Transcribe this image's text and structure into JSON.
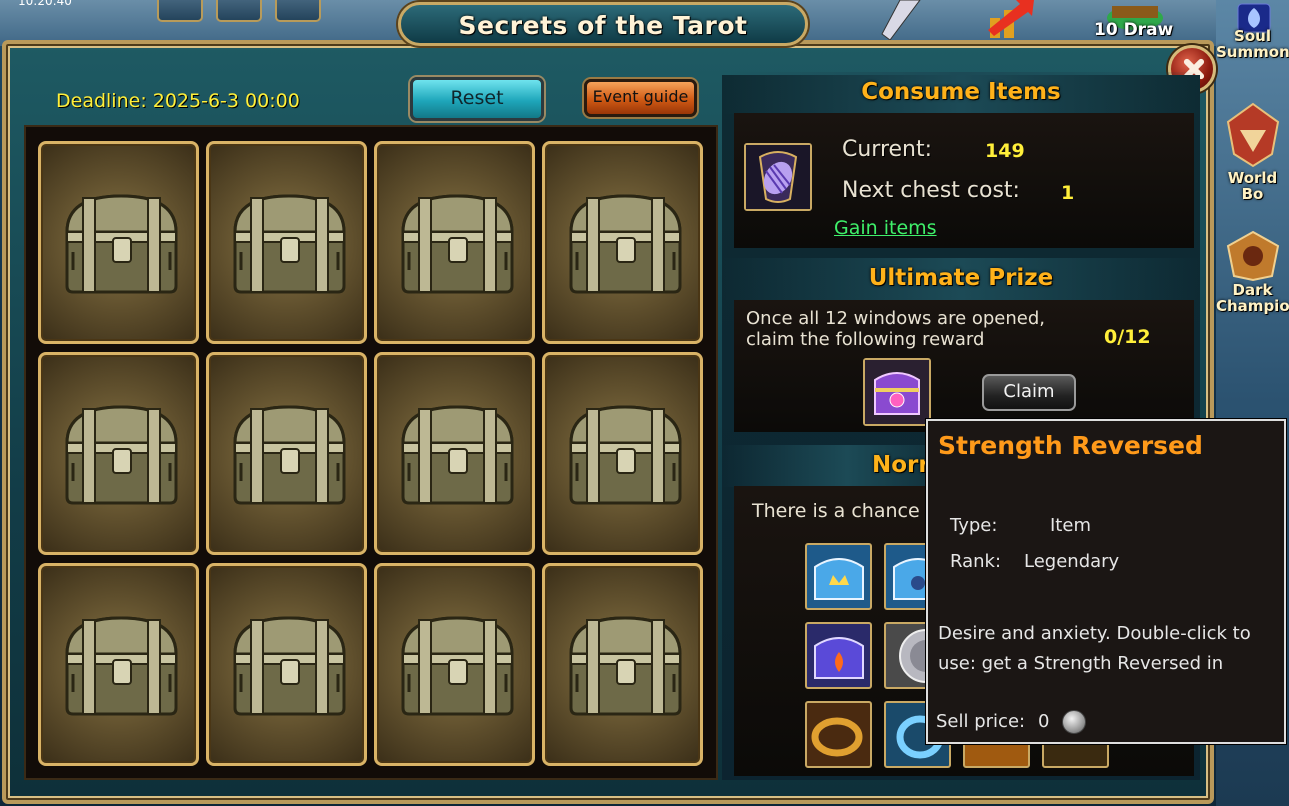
{
  "clock": "10:20:40",
  "top_icons": [
    {
      "label": "10 Draw",
      "icon": "gold-chest-icon"
    },
    {
      "label": "Soul",
      "icon": "soul-summon-icon"
    }
  ],
  "side_menu": [
    {
      "label": "Soul\nSummon",
      "icon": "soul-summon-icon"
    },
    {
      "label": "World Bo",
      "icon": "world-boss-icon"
    },
    {
      "label": "Dark\nChampio",
      "icon": "dark-champion-icon"
    }
  ],
  "window": {
    "title": "Secrets of the Tarot",
    "deadline": "Deadline: 2025-6-3 00:00",
    "reset_label": "Reset",
    "guide_label": "Event guide"
  },
  "chests": [
    {
      "state": "closed"
    },
    {
      "state": "closed"
    },
    {
      "state": "closed"
    },
    {
      "state": "closed"
    },
    {
      "state": "closed"
    },
    {
      "state": "closed"
    },
    {
      "state": "closed"
    },
    {
      "state": "closed"
    },
    {
      "state": "closed"
    },
    {
      "state": "closed"
    },
    {
      "state": "closed"
    },
    {
      "state": "closed"
    }
  ],
  "consume": {
    "heading": "Consume Items",
    "current_label": "Current:",
    "current_value": "149",
    "next_label": "Next chest cost:",
    "next_value": "1",
    "gain_link": "Gain items",
    "item_icon": "tarot-card-icon"
  },
  "ultimate": {
    "heading": "Ultimate Prize",
    "text": "Once all 12 windows are opened,\nclaim the following reward",
    "progress": "0/12",
    "claim_label": "Claim",
    "reward_icon": "purple-chest-icon"
  },
  "normal": {
    "heading": "Norr",
    "text": "There is a chance t",
    "items": [
      {
        "icon": "blue-crown-chest-icon"
      },
      {
        "icon": "blue-fleur-chest-icon"
      },
      {
        "icon": "purple-fire-chest-icon"
      },
      {
        "icon": "silver-coin-icon"
      },
      {
        "icon": "gold-ring-icon"
      },
      {
        "icon": "blue-ring-icon"
      },
      {
        "icon": "orange-item-icon"
      },
      {
        "icon": "gold-item-icon"
      }
    ]
  },
  "tooltip": {
    "title": "Strength Reversed",
    "type_label": "Type:",
    "type_value": "Item",
    "rank_label": "Rank:",
    "rank_value": "Legendary",
    "description": "Desire and anxiety. Double-click to use: get a Strength Reversed in",
    "sell_label": "Sell price:",
    "sell_value": "0"
  },
  "colors": {
    "accent_gold": "#ffb21a",
    "value_yellow": "#ffef3a",
    "link_green": "#3ff06a",
    "tooltip_title": "#ff9a1a",
    "frame_gold": "#d9b366"
  }
}
